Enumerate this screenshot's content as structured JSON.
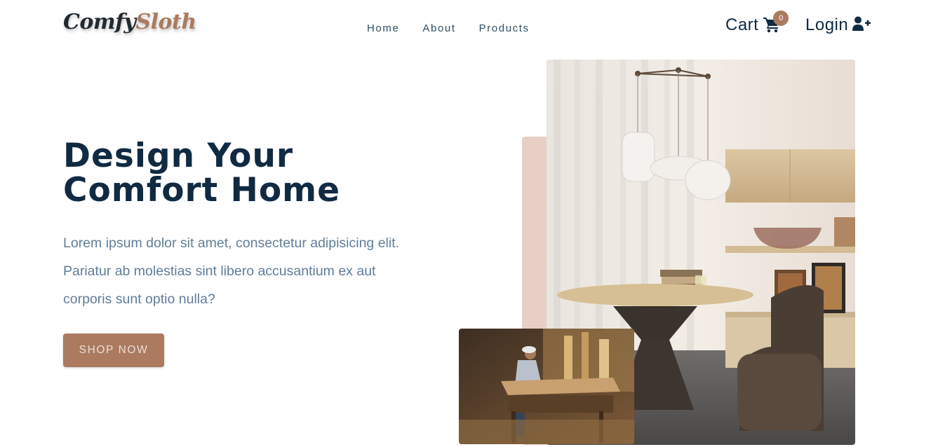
{
  "brand": {
    "part1": "Comfy",
    "part2": "Sloth",
    "primary_color": "#ab7a5f",
    "text_color": "#102a42"
  },
  "nav": {
    "links": [
      "Home",
      "About",
      "Products"
    ]
  },
  "header": {
    "cart_label": "Cart",
    "cart_count": "0",
    "login_label": "Login",
    "cart_icon": "cart-icon",
    "login_icon": "user-plus-icon"
  },
  "hero": {
    "title_line1": "Design Your",
    "title_line2": "Comfort Home",
    "text": "Lorem ipsum dolor sit amet, consectetur adipisicing elit. Pariatur ab molestias sint libero accusantium ex aut corporis sunt optio nulla?",
    "button_label": "SHOP NOW"
  }
}
